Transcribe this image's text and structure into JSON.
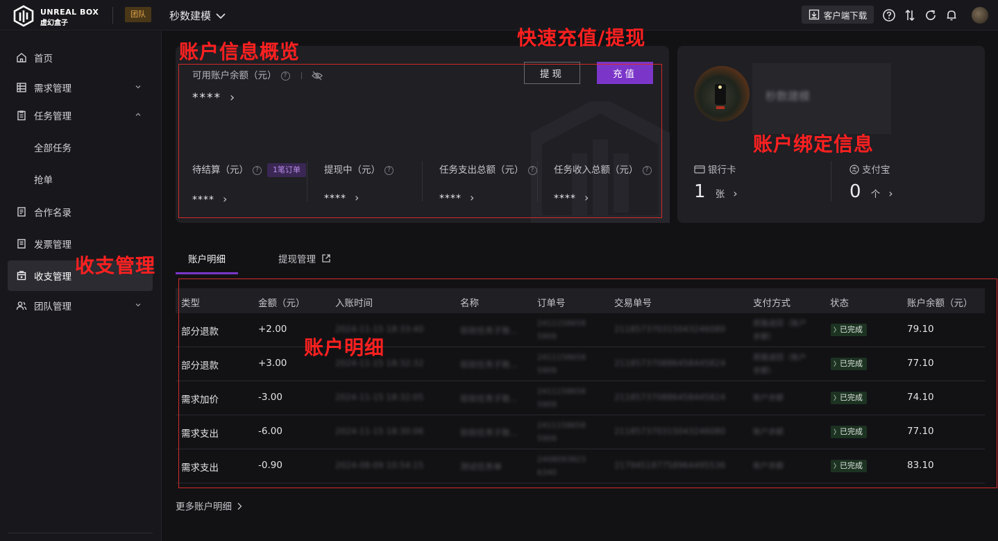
{
  "header": {
    "logo_en": "UNREAL BOX",
    "logo_cn": "虚幻盒子",
    "team_badge": "团队",
    "workspace": "秒数建模",
    "download_label": "客户端下载",
    "icons": [
      "help-icon",
      "sort-icon",
      "refresh-icon",
      "bell-icon",
      "user-avatar"
    ]
  },
  "sidebar": {
    "items": [
      {
        "label": "首页",
        "icon": "home-icon"
      },
      {
        "label": "需求管理",
        "icon": "table-icon"
      },
      {
        "label": "任务管理",
        "icon": "clipboard-icon"
      },
      {
        "label": "合作名录",
        "icon": "book-icon"
      },
      {
        "label": "发票管理",
        "icon": "receipt-icon"
      },
      {
        "label": "收支管理",
        "icon": "wallet-icon"
      },
      {
        "label": "团队管理",
        "icon": "team-icon"
      }
    ],
    "sub_items": [
      "全部任务",
      "抢单"
    ]
  },
  "annotations": {
    "overview": "账户信息概览",
    "quick": "快速充值/提现",
    "bind": "账户绑定信息",
    "income": "收支管理",
    "detail": "账户明细"
  },
  "account": {
    "balance_label": "可用账户余额（元）",
    "balance_value": "****",
    "withdraw_btn": "提现",
    "recharge_btn": "充值",
    "stats": [
      {
        "label": "待结算（元）",
        "value": "****",
        "badge": "1笔订单"
      },
      {
        "label": "提现中（元）",
        "value": "****"
      },
      {
        "label": "任务支出总额（元）",
        "value": "****"
      },
      {
        "label": "任务收入总额（元）",
        "value": "****"
      }
    ]
  },
  "binding": {
    "name": "秒数建模",
    "bank_label": "银行卡",
    "bank_count": "1",
    "bank_unit": "张",
    "alipay_label": "支付宝",
    "alipay_count": "0",
    "alipay_unit": "个"
  },
  "tabs": {
    "detail": "账户明细",
    "withdraw": "提现管理"
  },
  "table": {
    "headers": [
      "类型",
      "金额（元）",
      "入账时间",
      "名称",
      "订单号",
      "交易单号",
      "支付方式",
      "状态",
      "账户余额（元）"
    ],
    "rows": [
      {
        "type": "部分退款",
        "amount": "+2.00",
        "time": "2024-11-15 18:33:40",
        "name": "验验任务子账...",
        "order1": "2411158658",
        "order2": "5909",
        "txn": "211857370315043246080",
        "pay1": "原路退回（账户",
        "pay2": "余额）",
        "status": "已完成",
        "balance": "79.10"
      },
      {
        "type": "部分退款",
        "amount": "+3.00",
        "time": "2024-11-15 18:32:32",
        "name": "验验任务子账...",
        "order1": "2411158658",
        "order2": "5909",
        "txn": "211857370886458445824",
        "pay1": "原路退回（账户",
        "pay2": "余额）",
        "status": "已完成",
        "balance": "77.10"
      },
      {
        "type": "需求加价",
        "amount": "-3.00",
        "time": "2024-11-15 18:32:05",
        "name": "验验任务子账...",
        "order1": "2411158658",
        "order2": "5909",
        "txn": "211857370886458445824",
        "pay1": "账户余额",
        "pay2": "",
        "status": "已完成",
        "balance": "74.10"
      },
      {
        "type": "需求支出",
        "amount": "-6.00",
        "time": "2024-11-15 18:30:06",
        "name": "验验任务子账...",
        "order1": "2411158658",
        "order2": "5909",
        "txn": "211857370315043246080",
        "pay1": "账户余额",
        "pay2": "",
        "status": "已完成",
        "balance": "77.10"
      },
      {
        "type": "需求支出",
        "amount": "-0.90",
        "time": "2024-08-09 10:54:15",
        "name": "测试任务单",
        "order1": "2408093823",
        "order2": "6340",
        "txn": "217945187758964495536",
        "pay1": "账户余额",
        "pay2": "",
        "status": "已完成",
        "balance": "83.10"
      }
    ]
  },
  "more_link": "更多账户明细"
}
